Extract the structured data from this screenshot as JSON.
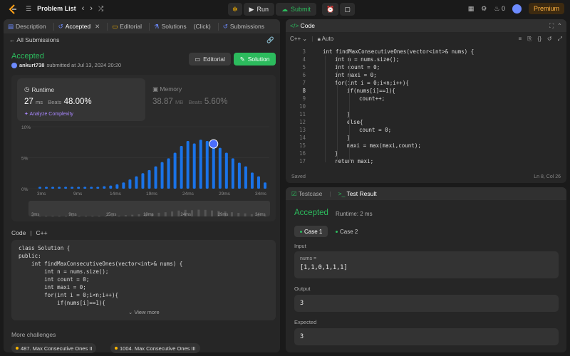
{
  "topbar": {
    "problem_list": "Problem List",
    "run": "Run",
    "submit": "Submit",
    "streak": "0",
    "premium": "Premium"
  },
  "left_tabs": [
    {
      "label": "Description",
      "icon": "description-icon"
    },
    {
      "label": "Accepted",
      "icon": "history-icon"
    },
    {
      "label": "Editorial",
      "icon": "book-icon"
    },
    {
      "label": "Solutions",
      "icon": "flask-icon"
    },
    {
      "label": "(Click)",
      "icon": ""
    },
    {
      "label": "Submissions",
      "icon": "history-icon"
    }
  ],
  "submission": {
    "back_label": "All Submissions",
    "status": "Accepted",
    "user": "ankurt738",
    "submitted_text": "submitted at Jul 13, 2024 20:20",
    "editorial_btn": "Editorial",
    "solution_btn": "Solution"
  },
  "runtime": {
    "label": "Runtime",
    "value": "27",
    "unit": "ms",
    "beats_label": "Beats",
    "beats": "48.00%",
    "analyze": "Analyze Complexity"
  },
  "memory": {
    "label": "Memory",
    "value": "38.87",
    "unit": "MB",
    "beats_label": "Beats",
    "beats": "5.60%"
  },
  "chart_data": {
    "type": "bar",
    "ylim": [
      0,
      10
    ],
    "y_ticks": [
      "10%",
      "5%",
      "0%"
    ],
    "x_ticks": [
      "3ms",
      "9ms",
      "14ms",
      "19ms",
      "24ms",
      "29ms",
      "34ms"
    ],
    "mini_ticks": [
      "3ms",
      "9ms",
      "15ms",
      "19ms",
      "24ms",
      "29ms",
      "34ms"
    ],
    "values": [
      0.3,
      0.3,
      0.3,
      0.3,
      0.3,
      0.3,
      0.3,
      0.3,
      0.3,
      0.3,
      0.4,
      0.5,
      0.7,
      1.0,
      1.5,
      2.0,
      2.5,
      3.0,
      3.6,
      4.3,
      4.9,
      5.8,
      6.9,
      7.7,
      7.3,
      7.9,
      7.7,
      7.0,
      6.6,
      5.8,
      4.9,
      4.2,
      3.6,
      2.6,
      2.0,
      1.0
    ],
    "highlight_index": 27,
    "accent": "#1a73e8"
  },
  "code_preview": {
    "label": "Code",
    "lang": "C++",
    "lines": [
      "class Solution {",
      "public:",
      "    int findMaxConsecutiveOnes(vector<int>& nums) {",
      "        int n = nums.size();",
      "        int count = 0;",
      "        int maxi = 0;",
      "        for(int i = 0;i<n;i++){",
      "            if(nums[i]==1){"
    ],
    "view_more": "View more"
  },
  "more_challenges": {
    "label": "More challenges",
    "items": [
      "487. Max Consecutive Ones II",
      "1004. Max Consecutive Ones III"
    ]
  },
  "editor": {
    "title": "Code",
    "lang": "C++",
    "auto": "Auto",
    "status": "Saved",
    "position": "Ln 8, Col 26",
    "lines": [
      {
        "n": "3",
        "indent": 0,
        "text": "int findMaxConsecutiveOnes(vector<int>& nums) {"
      },
      {
        "n": "4",
        "indent": 1,
        "text": "int n = nums.size();"
      },
      {
        "n": "5",
        "indent": 1,
        "text": "int count = 0;"
      },
      {
        "n": "6",
        "indent": 1,
        "text": "int maxi = 0;"
      },
      {
        "n": "7",
        "indent": 1,
        "text": "for(int i = 0;i<n;i++){"
      },
      {
        "n": "8",
        "indent": 2,
        "text": "if(nums[i]==1){"
      },
      {
        "n": "9",
        "indent": 3,
        "text": "count++;"
      },
      {
        "n": "10",
        "indent": 0,
        "text": ""
      },
      {
        "n": "11",
        "indent": 2,
        "text": "}"
      },
      {
        "n": "12",
        "indent": 2,
        "text": "else{"
      },
      {
        "n": "13",
        "indent": 3,
        "text": "count = 0;"
      },
      {
        "n": "14",
        "indent": 2,
        "text": "}"
      },
      {
        "n": "15",
        "indent": 2,
        "text": "maxi = max(maxi,count);"
      },
      {
        "n": "16",
        "indent": 1,
        "text": "}"
      },
      {
        "n": "17",
        "indent": 1,
        "text": "return maxi;"
      }
    ]
  },
  "testpanel": {
    "tab_testcase": "Testcase",
    "tab_result": "Test Result",
    "status": "Accepted",
    "runtime": "Runtime: 2 ms",
    "case1": "Case 1",
    "case2": "Case 2",
    "input_label": "Input",
    "var_name": "nums =",
    "input_value": "[1,1,0,1,1,1]",
    "output_label": "Output",
    "output_value": "3",
    "expected_label": "Expected",
    "expected_value": "3"
  }
}
